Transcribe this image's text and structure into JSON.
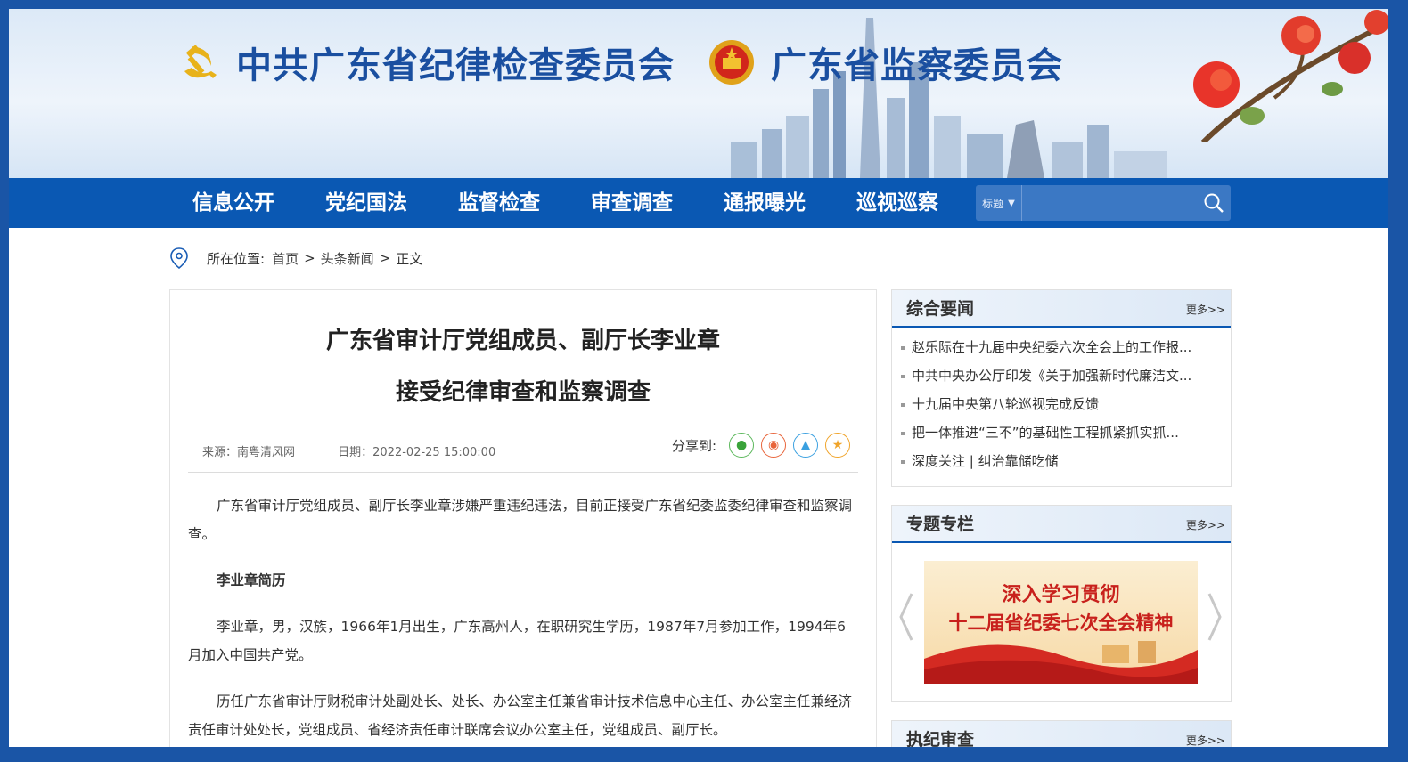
{
  "header": {
    "title_cpc": "中共广东省纪律检查委员会",
    "title_supervision": "广东省监察委员会"
  },
  "nav": {
    "items": [
      {
        "label": "信息公开"
      },
      {
        "label": "党纪国法"
      },
      {
        "label": "监督检查"
      },
      {
        "label": "审查调查"
      },
      {
        "label": "通报曝光"
      },
      {
        "label": "巡视巡察"
      }
    ],
    "search": {
      "selected": "标题",
      "value": ""
    }
  },
  "breadcrumb": {
    "prefix": "所在位置:",
    "items": [
      "首页",
      "头条新闻",
      "正文"
    ],
    "separator": ">"
  },
  "article": {
    "title_line1": "广东省审计厅党组成员、副厅长李业章",
    "title_line2": "接受纪律审查和监察调查",
    "source": "来源：南粤清风网",
    "date": "日期：2022-02-25 15:00:00",
    "share_label": "分享到:",
    "share_icons": [
      "wechat-icon",
      "weibo-icon",
      "qq-icon",
      "favorite-icon"
    ],
    "paragraphs": [
      "广东省审计厅党组成员、副厅长李业章涉嫌严重违纪违法，目前正接受广东省纪委监委纪律审查和监察调查。",
      "李业章简历",
      "李业章，男，汉族，1966年1月出生，广东高州人，在职研究生学历，1987年7月参加工作，1994年6月加入中国共产党。",
      "历任广东省审计厅财税审计处副处长、处长、办公室主任兼省审计技术信息中心主任、办公室主任兼经济责任审计处处长，党组成员、省经济责任审计联席会议办公室主任，党组成员、副厅长。"
    ]
  },
  "sidebar": {
    "news": {
      "title": "综合要闻",
      "more": "更多>>",
      "items": [
        "赵乐际在十九届中央纪委六次全会上的工作报...",
        "中共中央办公厅印发《关于加强新时代廉洁文...",
        "十九届中央第八轮巡视完成反馈",
        "把一体推进“三不”的基础性工程抓紧抓实抓...",
        "深度关注 | 纠治靠储吃储"
      ]
    },
    "special": {
      "title": "专题专栏",
      "more": "更多>>",
      "banner_line1": "深入学习贯彻",
      "banner_line2": "十二届省纪委七次全会精神"
    },
    "discipline": {
      "title": "执纪审查",
      "more": "更多>>"
    }
  },
  "colors": {
    "brand_blue": "#0a58b3",
    "title_blue": "#1a4fa0",
    "frame_blue": "#1a55a6"
  }
}
